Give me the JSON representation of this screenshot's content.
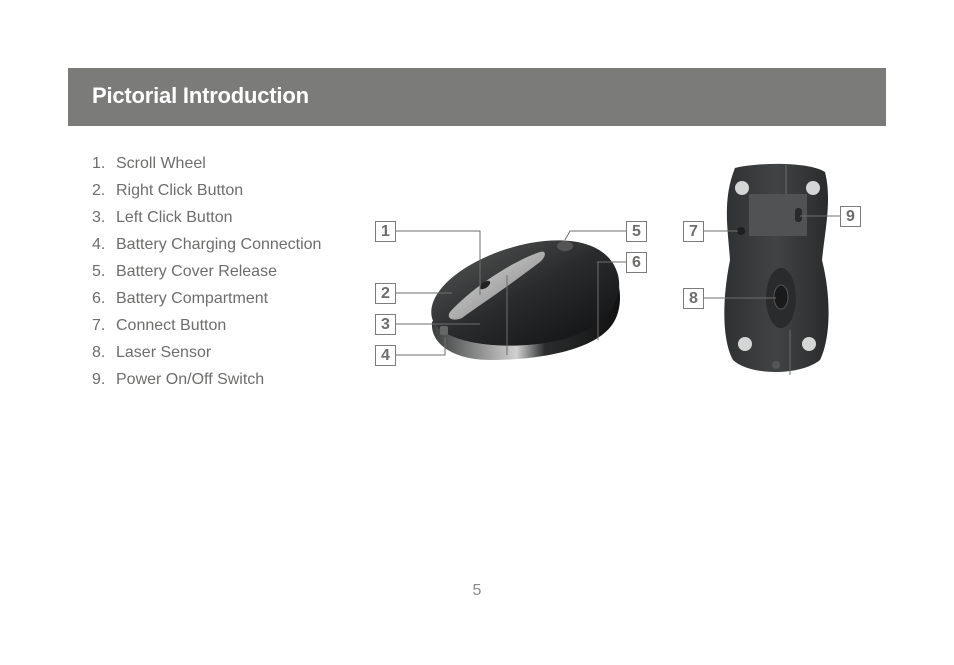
{
  "header": {
    "title": "Pictorial Introduction"
  },
  "parts": [
    {
      "number": "1.",
      "label": "Scroll Wheel"
    },
    {
      "number": "2.",
      "label": "Right Click Button"
    },
    {
      "number": "3.",
      "label": "Left Click Button"
    },
    {
      "number": "4.",
      "label": "Battery Charging Connection"
    },
    {
      "number": "5.",
      "label": "Battery Cover Release"
    },
    {
      "number": "6.",
      "label": "Battery Compartment"
    },
    {
      "number": "7.",
      "label": "Connect Button"
    },
    {
      "number": "8.",
      "label": "Laser Sensor"
    },
    {
      "number": "9.",
      "label": "Power On/Off Switch"
    }
  ],
  "callouts": {
    "c1": "1",
    "c2": "2",
    "c3": "3",
    "c4": "4",
    "c5": "5",
    "c6": "6",
    "c7": "7",
    "c8": "8",
    "c9": "9"
  },
  "footer": {
    "page_number": "5"
  }
}
